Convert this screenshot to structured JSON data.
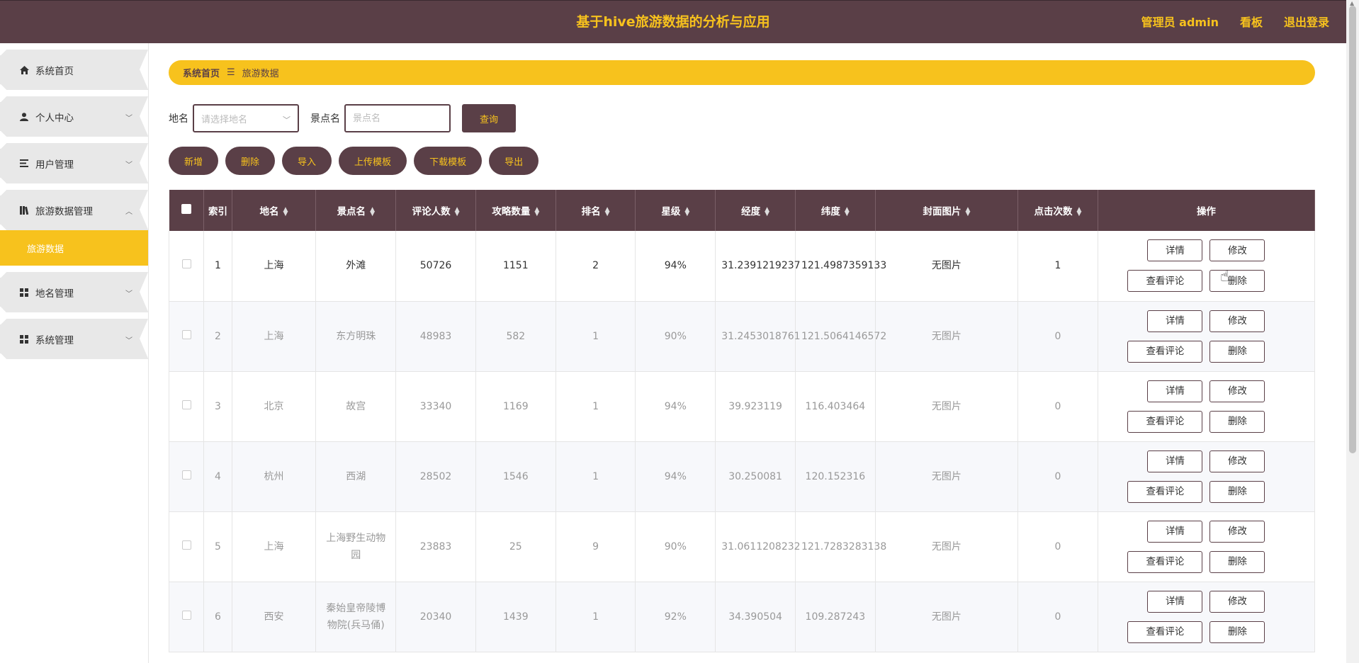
{
  "header": {
    "title": "基于hive旅游数据的分析与应用",
    "admin": "管理员 admin",
    "board": "看板",
    "logout": "退出登录"
  },
  "sidebar": {
    "items": [
      {
        "label": "系统首页",
        "icon": "home-icon"
      },
      {
        "label": "个人中心",
        "icon": "user-icon"
      },
      {
        "label": "用户管理",
        "icon": "list-icon"
      },
      {
        "label": "旅游数据管理",
        "icon": "books-icon"
      },
      {
        "label": "地名管理",
        "icon": "grid-icon"
      },
      {
        "label": "系统管理",
        "icon": "grid-icon"
      }
    ],
    "sub_active": "旅游数据"
  },
  "breadcrumb": {
    "home": "系统首页",
    "sep": "☰",
    "current": "旅游数据"
  },
  "search": {
    "place_label": "地名",
    "place_placeholder": "请选择地名",
    "spot_label": "景点名",
    "spot_placeholder": "景点名",
    "query_btn": "查询"
  },
  "actions": [
    "新增",
    "删除",
    "导入",
    "上传模板",
    "下载模板",
    "导出"
  ],
  "table": {
    "headers": [
      "索引",
      "地名",
      "景点名",
      "评论人数",
      "攻略数量",
      "排名",
      "星级",
      "经度",
      "纬度",
      "封面图片",
      "点击次数",
      "操作"
    ],
    "ops": {
      "detail": "详情",
      "edit": "修改",
      "comments": "查看评论",
      "delete": "删除"
    },
    "rows": [
      {
        "idx": "1",
        "place": "上海",
        "spot": "外滩",
        "comments": "50726",
        "guides": "1151",
        "rank": "2",
        "star": "94%",
        "lng": "31.2391219237",
        "lat": "121.4987359133",
        "cover": "无图片",
        "clicks": "1"
      },
      {
        "idx": "2",
        "place": "上海",
        "spot": "东方明珠",
        "comments": "48983",
        "guides": "582",
        "rank": "1",
        "star": "90%",
        "lng": "31.2453018761",
        "lat": "121.5064146572",
        "cover": "无图片",
        "clicks": "0"
      },
      {
        "idx": "3",
        "place": "北京",
        "spot": "故宫",
        "comments": "33340",
        "guides": "1169",
        "rank": "1",
        "star": "94%",
        "lng": "39.923119",
        "lat": "116.403464",
        "cover": "无图片",
        "clicks": "0"
      },
      {
        "idx": "4",
        "place": "杭州",
        "spot": "西湖",
        "comments": "28502",
        "guides": "1546",
        "rank": "1",
        "star": "94%",
        "lng": "30.250081",
        "lat": "120.152316",
        "cover": "无图片",
        "clicks": "0"
      },
      {
        "idx": "5",
        "place": "上海",
        "spot": "上海野生动物园",
        "comments": "23883",
        "guides": "25",
        "rank": "9",
        "star": "90%",
        "lng": "31.0611208232",
        "lat": "121.7283283138",
        "cover": "无图片",
        "clicks": "0"
      },
      {
        "idx": "6",
        "place": "西安",
        "spot": "秦始皇帝陵博物院(兵马俑)",
        "comments": "20340",
        "guides": "1439",
        "rank": "1",
        "star": "92%",
        "lng": "34.390504",
        "lat": "109.287243",
        "cover": "无图片",
        "clicks": "0"
      }
    ]
  }
}
